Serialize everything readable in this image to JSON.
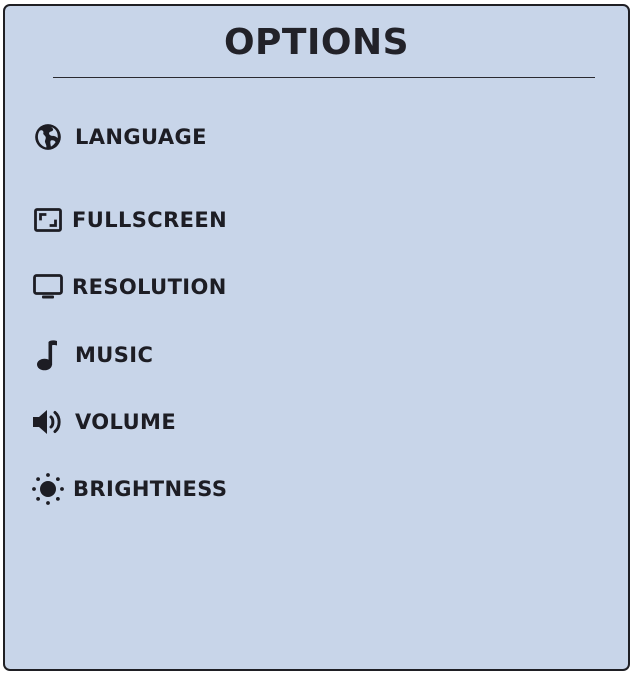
{
  "panel": {
    "title": "OPTIONS"
  },
  "options": [
    {
      "id": "language",
      "label": "LANGUAGE",
      "icon": "globe-icon"
    },
    {
      "id": "fullscreen",
      "label": "FULLSCREEN",
      "icon": "fullscreen-icon"
    },
    {
      "id": "resolution",
      "label": "RESOLUTION",
      "icon": "monitor-icon"
    },
    {
      "id": "music",
      "label": "MUSIC",
      "icon": "music-note-icon"
    },
    {
      "id": "volume",
      "label": "VOLUME",
      "icon": "speaker-icon"
    },
    {
      "id": "brightness",
      "label": "BRIGHTNESS",
      "icon": "sun-icon"
    }
  ],
  "colors": {
    "panel_background": "#c8d5e9",
    "text": "#1d1d24",
    "border": "#1f1f24"
  }
}
